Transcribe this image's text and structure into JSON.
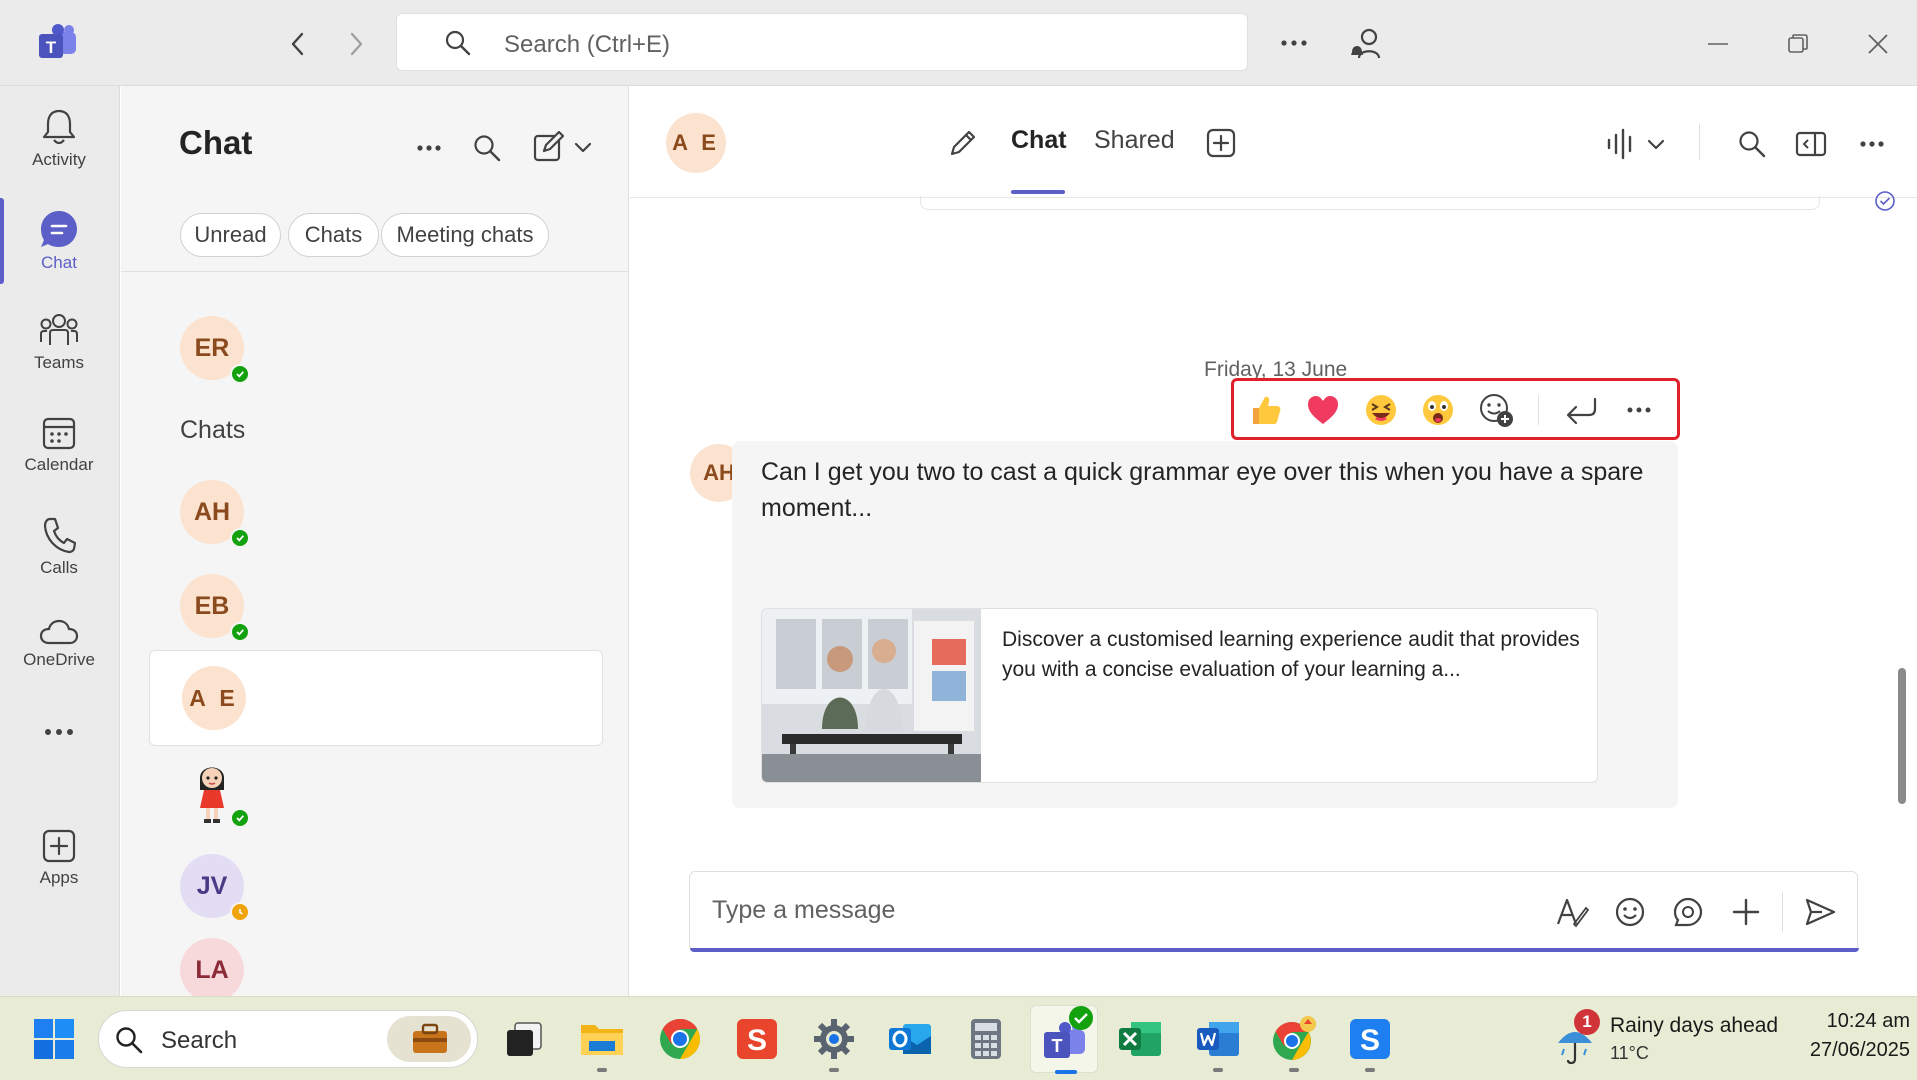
{
  "titlebar": {
    "search_placeholder": "Search (Ctrl+E)",
    "app_icon": "teams-logo",
    "back_icon": "chevron-left-icon",
    "forward_icon": "chevron-right-icon",
    "more_icon": "ellipsis-icon",
    "people_icon": "person-bell-icon",
    "window_controls": [
      "minimize-icon",
      "restore-icon",
      "close-icon"
    ]
  },
  "rail": {
    "items": [
      {
        "label": "Activity",
        "icon": "bell-icon"
      },
      {
        "label": "Chat",
        "icon": "chat-bubble-icon",
        "active": true
      },
      {
        "label": "Teams",
        "icon": "people-group-icon"
      },
      {
        "label": "Calendar",
        "icon": "calendar-icon"
      },
      {
        "label": "Calls",
        "icon": "phone-icon"
      },
      {
        "label": "OneDrive",
        "icon": "cloud-icon"
      },
      {
        "label": "",
        "icon": "ellipsis-icon"
      },
      {
        "label": "Apps",
        "icon": "plus-square-icon"
      }
    ],
    "accent": "#5b5fc7"
  },
  "chat_list": {
    "title": "Chat",
    "filters": [
      "Unread",
      "Chats",
      "Meeting chats"
    ],
    "pinned": [
      {
        "initials": "ER",
        "presence": "available"
      }
    ],
    "section_label": "Chats",
    "chats": [
      {
        "initials": "AH",
        "presence": "available"
      },
      {
        "initials": "EB",
        "presence": "available"
      },
      {
        "initials": "A E",
        "presence": "",
        "selected": true
      },
      {
        "initials": "",
        "avatar": "cartoon-person",
        "presence": "available"
      },
      {
        "initials": "JV",
        "presence": "away"
      },
      {
        "initials": "LA",
        "presence": ""
      }
    ]
  },
  "conversation": {
    "avatar_initials": "A E",
    "tabs": [
      "Chat",
      "Shared"
    ],
    "active_tab": "Chat",
    "date_divider": "Friday, 13 June",
    "message": {
      "sender_initials": "AH",
      "text": "Can I get you two to cast a quick grammar eye over this when you have a spare moment...",
      "link_preview": {
        "description": "Discover a customised learning experience audit that provides you with a concise evaluation of your learning a..."
      }
    },
    "reactions": [
      "thumbs-up-icon",
      "heart-icon",
      "laughing-face-icon",
      "surprised-face-icon",
      "add-reaction-icon",
      "reply-icon",
      "more-icon"
    ],
    "compose_placeholder": "Type a message"
  },
  "taskbar": {
    "search_label": "Search",
    "weather_title": "Rainy days ahead",
    "weather_temp": "11°C",
    "weather_badge": "1",
    "time": "10:24 am",
    "date": "27/06/2025"
  }
}
